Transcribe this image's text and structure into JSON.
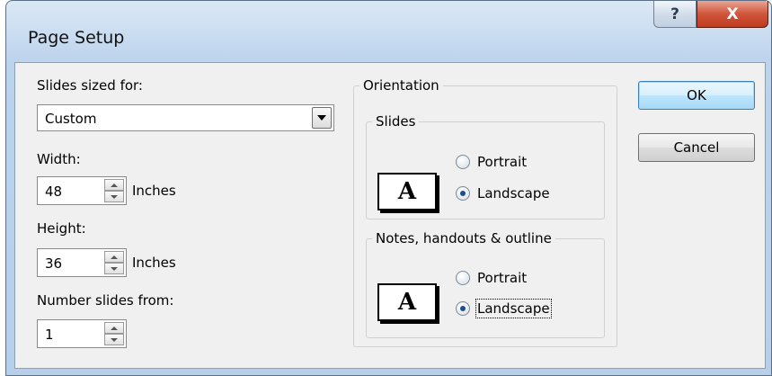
{
  "window": {
    "title": "Page Setup",
    "help_glyph": "?",
    "close_glyph": "X"
  },
  "slides_sized_for": {
    "label": "Slides sized for:",
    "value": "Custom"
  },
  "width": {
    "label": "Width:",
    "value": "48",
    "unit": "Inches"
  },
  "height": {
    "label": "Height:",
    "value": "36",
    "unit": "Inches"
  },
  "number_slides_from": {
    "label": "Number slides from:",
    "value": "1"
  },
  "orientation": {
    "legend": "Orientation",
    "slides": {
      "legend": "Slides",
      "portrait": "Portrait",
      "landscape": "Landscape",
      "selected": "Landscape"
    },
    "notes": {
      "legend": "Notes, handouts & outline",
      "portrait": "Portrait",
      "landscape": "Landscape",
      "selected": "Landscape"
    },
    "icon_letter": "A"
  },
  "buttons": {
    "ok": "OK",
    "cancel": "Cancel"
  }
}
